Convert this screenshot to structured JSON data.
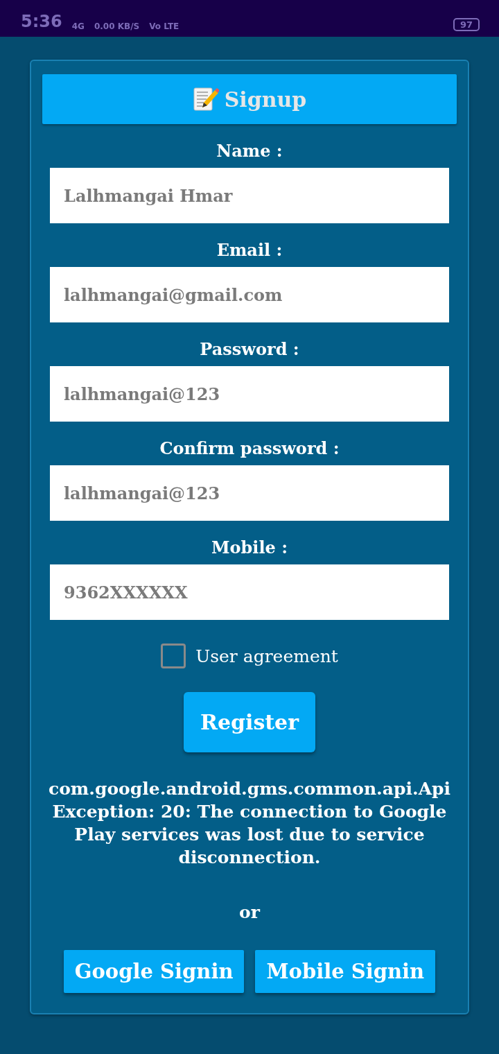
{
  "status_bar": {
    "time": "5:36",
    "network": "4G",
    "speed": "0.00 KB/S",
    "lte": "Vo LTE",
    "battery": "97"
  },
  "header": {
    "title": "Signup"
  },
  "fields": [
    {
      "label": "Name :",
      "value": "Lalhmangai Hmar"
    },
    {
      "label": "Email :",
      "value": "lalhmangai@gmail.com"
    },
    {
      "label": "Password :",
      "value": "lalhmangai@123"
    },
    {
      "label": "Confirm password :",
      "value": "lalhmangai@123"
    },
    {
      "label": "Mobile :",
      "value": "9362XXXXXX"
    }
  ],
  "agreement": {
    "label": "User agreement",
    "checked": false
  },
  "register_button": "Register",
  "error_message": "com.google.android.gms.common.api.ApiException: 20: The connection to Google Play services was lost due to service disconnection.",
  "separator": "or",
  "signin_buttons": [
    "Google Signin",
    "Mobile Signin"
  ]
}
